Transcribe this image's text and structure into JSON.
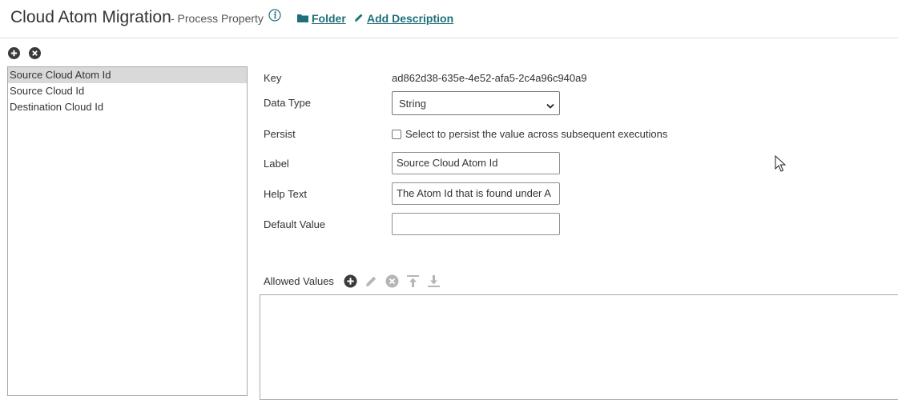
{
  "header": {
    "title": "Cloud Atom Migration",
    "subtitle": "- Process Property",
    "folder_label": "Folder",
    "add_description_label": "Add Description"
  },
  "properties": {
    "items": [
      {
        "label": "Source Cloud Atom Id",
        "selected": true
      },
      {
        "label": "Source Cloud Id",
        "selected": false
      },
      {
        "label": "Destination Cloud Id",
        "selected": false
      }
    ]
  },
  "form": {
    "key_label": "Key",
    "key_value": "ad862d38-635e-4e52-afa5-2c4a96c940a9",
    "data_type_label": "Data Type",
    "data_type_value": "String",
    "persist_label": "Persist",
    "persist_checked": false,
    "persist_text": "Select to persist the value across subsequent executions",
    "label_label": "Label",
    "label_value": "Source Cloud Atom Id",
    "help_text_label": "Help Text",
    "help_text_value": "The Atom Id that is found under A",
    "default_value_label": "Default Value",
    "default_value": ""
  },
  "allowed_values": {
    "label": "Allowed Values"
  },
  "colors": {
    "link": "#1f6f7a",
    "selected_row": "#d9d9d9",
    "icon_dark": "#3a3a3a",
    "icon_disabled": "#b5b5b5"
  },
  "icons": {
    "info": "info-icon",
    "folder": "folder-icon",
    "pencil": "pencil-icon",
    "add": "plus-circle-icon",
    "remove": "x-circle-icon",
    "move_top": "move-to-top-icon",
    "move_bottom": "move-to-bottom-icon"
  }
}
